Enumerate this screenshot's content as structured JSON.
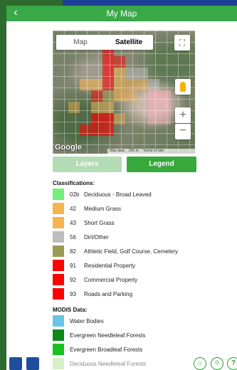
{
  "header": {
    "title": "My Map",
    "back_icon": "‹"
  },
  "map": {
    "toggle": [
      "Map",
      "Satellite"
    ],
    "active_toggle": "Satellite",
    "google": "Google",
    "attribution": [
      "Map data",
      "200 m",
      "Terms of Use"
    ]
  },
  "tabs": {
    "layers": "Layers",
    "legend": "Legend"
  },
  "classifications": {
    "title": "Classifications:",
    "items": [
      {
        "code": "02b",
        "label": "Deciduous - Broad Leaved",
        "color": "#74f07a"
      },
      {
        "code": "42",
        "label": "Medium Grass",
        "color": "#f6b44f"
      },
      {
        "code": "43",
        "label": "Short Grass",
        "color": "#f6b44f"
      },
      {
        "code": "56",
        "label": "Dirt/Other",
        "color": "#bdbdbd"
      },
      {
        "code": "82",
        "label": "Athletic Field, Golf Course, Cemetery",
        "color": "#9c9a52"
      },
      {
        "code": "91",
        "label": "Residential Property",
        "color": "#ff0000"
      },
      {
        "code": "92",
        "label": "Commercial Property",
        "color": "#ff0000"
      },
      {
        "code": "93",
        "label": "Roads and Parking",
        "color": "#ff0000"
      }
    ]
  },
  "modis": {
    "title": "MODIS Data:",
    "items": [
      {
        "label": "Water Bodies",
        "color": "#67c6e8"
      },
      {
        "label": "Evergreen Needleleaf Forests",
        "color": "#0b8a1b"
      },
      {
        "label": "Evergreen Broadleaf Forests",
        "color": "#19c21c"
      },
      {
        "label": "Deciduous Needleleaf Forests",
        "color": "#b7e59a"
      }
    ]
  },
  "bottom": {
    "help": "?"
  }
}
